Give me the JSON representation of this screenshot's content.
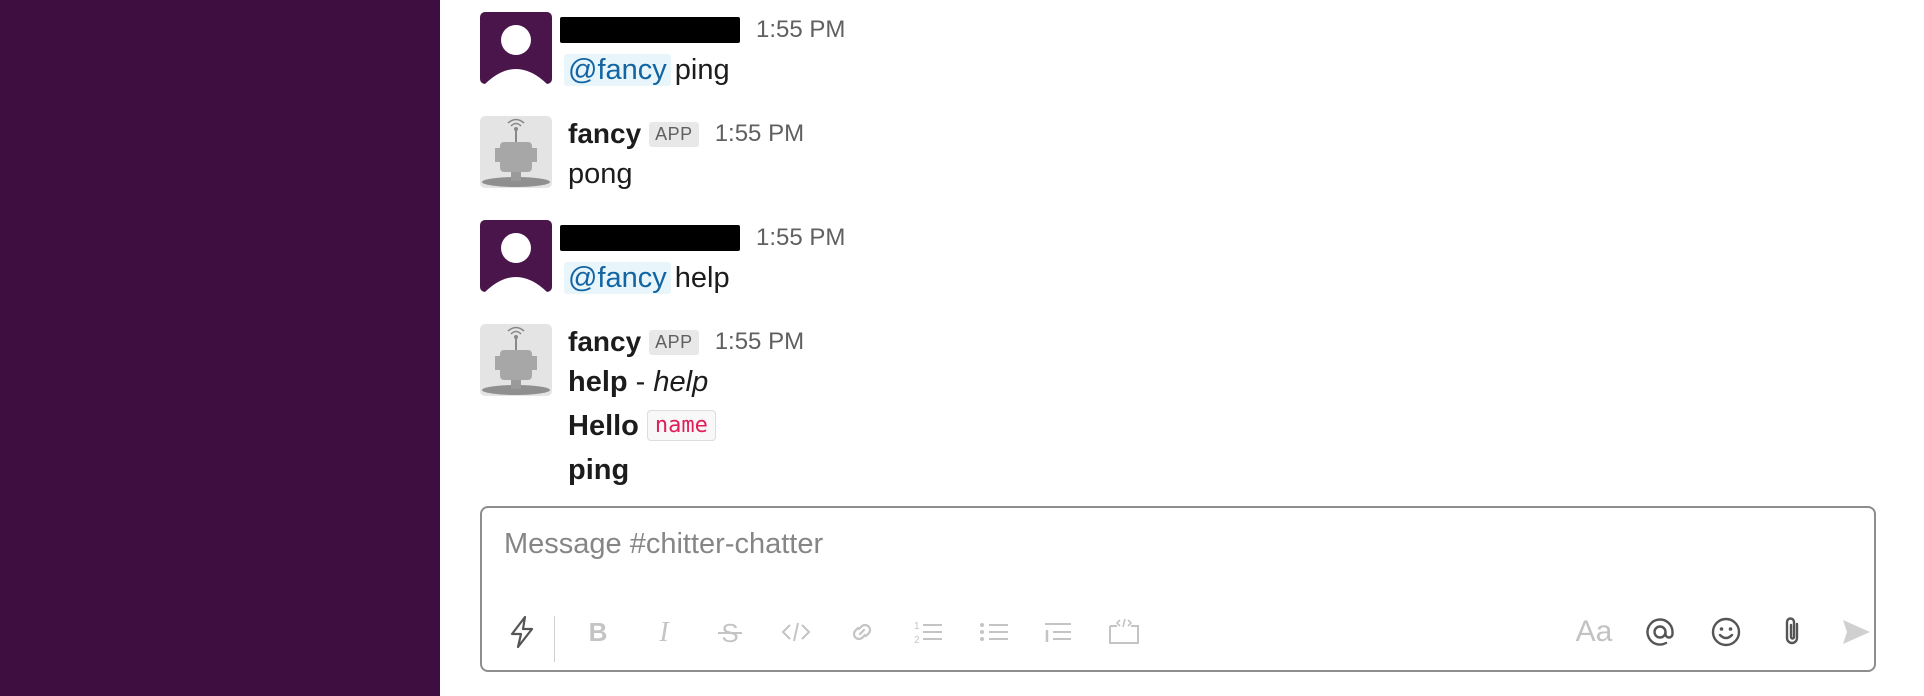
{
  "messages": [
    {
      "sender": "",
      "redacted": true,
      "time": "1:55 PM",
      "mention": "@fancy",
      "text": "ping"
    },
    {
      "sender": "fancy",
      "badge": "APP",
      "time": "1:55 PM",
      "text": "pong"
    },
    {
      "sender": "",
      "redacted": true,
      "time": "1:55 PM",
      "mention": "@fancy",
      "text": "help"
    },
    {
      "sender": "fancy",
      "badge": "APP",
      "time": "1:55 PM",
      "lines": {
        "help_cmd": "help",
        "help_sep": " - ",
        "help_desc": "help",
        "hello_cmd": "Hello",
        "hello_arg": "name",
        "ping_cmd": "ping"
      }
    }
  ],
  "composer": {
    "placeholder": "Message #chitter-chatter",
    "format_label": "Aa"
  },
  "toolbar_icons": [
    "shortcuts-icon",
    "bold-icon",
    "italic-icon",
    "strikethrough-icon",
    "code-icon",
    "link-icon",
    "ordered-list-icon",
    "bulleted-list-icon",
    "blockquote-icon",
    "code-block-icon",
    "format-toggle-icon",
    "mention-icon",
    "emoji-icon",
    "attachment-icon",
    "send-icon"
  ],
  "colors": {
    "sidebar": "#3f0e40",
    "mention_bg": "#e8f5fa",
    "mention_text": "#1264a3",
    "code_text": "#e01e5a"
  }
}
